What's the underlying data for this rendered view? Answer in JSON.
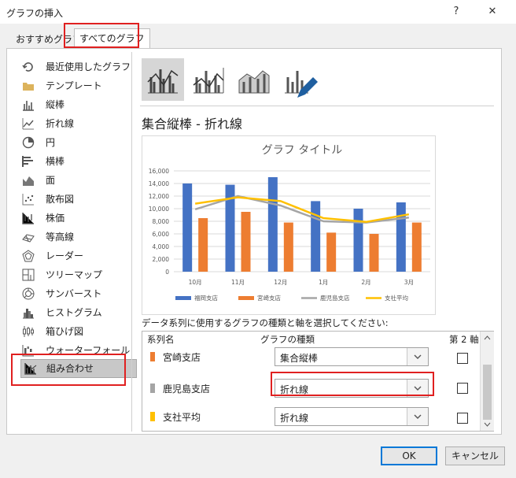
{
  "window": {
    "title": "グラフの挿入",
    "help_label": "?",
    "close_label": "✕"
  },
  "tabs": [
    {
      "label": "おすすめグラフ"
    },
    {
      "label": "すべてのグラフ"
    }
  ],
  "sidebar": {
    "items": [
      {
        "label": "最近使用したグラフ",
        "icon": "recent-icon"
      },
      {
        "label": "テンプレート",
        "icon": "folder-icon"
      },
      {
        "label": "縦棒",
        "icon": "column-chart-icon"
      },
      {
        "label": "折れ線",
        "icon": "line-chart-icon"
      },
      {
        "label": "円",
        "icon": "pie-chart-icon"
      },
      {
        "label": "横棒",
        "icon": "bar-chart-icon"
      },
      {
        "label": "面",
        "icon": "area-chart-icon"
      },
      {
        "label": "散布図",
        "icon": "scatter-chart-icon"
      },
      {
        "label": "株価",
        "icon": "stock-chart-icon"
      },
      {
        "label": "等高線",
        "icon": "surface-chart-icon"
      },
      {
        "label": "レーダー",
        "icon": "radar-chart-icon"
      },
      {
        "label": "ツリーマップ",
        "icon": "treemap-icon"
      },
      {
        "label": "サンバースト",
        "icon": "sunburst-icon"
      },
      {
        "label": "ヒストグラム",
        "icon": "histogram-icon"
      },
      {
        "label": "箱ひげ図",
        "icon": "boxwhisker-icon"
      },
      {
        "label": "ウォーターフォール",
        "icon": "waterfall-icon"
      },
      {
        "label": "組み合わせ",
        "icon": "combo-chart-icon"
      }
    ]
  },
  "combo_title": "集合縦棒 - 折れ線",
  "instruction": "データ系列に使用するグラフの種類と軸を選択してください:",
  "grid": {
    "headers": {
      "name": "系列名",
      "type": "グラフの種類",
      "axis": "第 2 軸"
    },
    "rows": [
      {
        "name": "宮崎支店",
        "type": "集合縦棒",
        "color": "#ed7d31"
      },
      {
        "name": "鹿児島支店",
        "type": "折れ線",
        "color": "#a5a5a5"
      },
      {
        "name": "支社平均",
        "type": "折れ線",
        "color": "#ffc000"
      }
    ]
  },
  "buttons": {
    "ok": "OK",
    "cancel": "キャンセル"
  },
  "chart_data": {
    "type": "bar",
    "title": "グラフ タイトル",
    "categories": [
      "10月",
      "11月",
      "12月",
      "1月",
      "2月",
      "3月"
    ],
    "ylim": [
      0,
      16000
    ],
    "yticks": [
      "0",
      "2,000",
      "4,000",
      "6,000",
      "8,000",
      "10,000",
      "12,000",
      "14,000",
      "16,000"
    ],
    "grid": true,
    "legend": "bottom",
    "series": [
      {
        "name": "福岡支店",
        "kind": "bar",
        "color": "#4472c4",
        "values": [
          14000,
          13800,
          15000,
          11200,
          10000,
          11000
        ]
      },
      {
        "name": "宮崎支店",
        "kind": "bar",
        "color": "#ed7d31",
        "values": [
          8500,
          9500,
          7800,
          6200,
          6000,
          7800
        ]
      },
      {
        "name": "鹿児島支店",
        "kind": "line",
        "color": "#a5a5a5",
        "values": [
          9900,
          12000,
          10500,
          8000,
          7800,
          8600
        ]
      },
      {
        "name": "支社平均",
        "kind": "line",
        "color": "#ffc000",
        "values": [
          10800,
          11800,
          11200,
          8500,
          7900,
          9100
        ]
      }
    ]
  }
}
